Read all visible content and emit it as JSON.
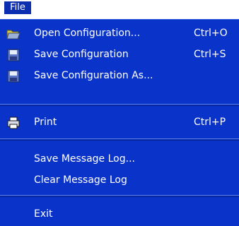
{
  "menubar": {
    "file_label": "File"
  },
  "menu": {
    "items": [
      {
        "label": "Open Configuration...",
        "shortcut": "Ctrl+O",
        "icon": "open-folder-icon"
      },
      {
        "label": "Save Configuration",
        "shortcut": "Ctrl+S",
        "icon": "floppy-disk-icon"
      },
      {
        "label": "Save Configuration As...",
        "shortcut": "",
        "icon": "floppy-disk-icon"
      },
      {
        "label": "Print",
        "shortcut": "Ctrl+P",
        "icon": "printer-icon"
      },
      {
        "label": "Save Message Log...",
        "shortcut": ""
      },
      {
        "label": "Clear Message Log",
        "shortcut": ""
      },
      {
        "label": "Exit",
        "shortcut": ""
      }
    ]
  },
  "colors": {
    "menu_background": "#0a34c9",
    "menubar_highlight": "#0b2fb0",
    "text": "#ffffff"
  }
}
